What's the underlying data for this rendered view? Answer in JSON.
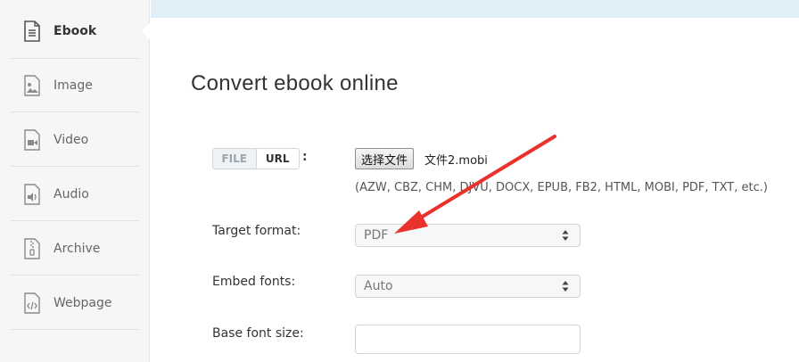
{
  "sidebar": {
    "items": [
      {
        "label": "Ebook",
        "icon": "ebook-icon",
        "active": true
      },
      {
        "label": "Image",
        "icon": "image-icon"
      },
      {
        "label": "Video",
        "icon": "video-icon"
      },
      {
        "label": "Audio",
        "icon": "audio-icon"
      },
      {
        "label": "Archive",
        "icon": "archive-icon"
      },
      {
        "label": "Webpage",
        "icon": "webpage-icon"
      }
    ]
  },
  "main": {
    "title": "Convert ebook online",
    "source_toggle": {
      "file": "FILE",
      "url": "URL",
      "selected": "URL"
    },
    "colon": ":",
    "file_button_label": "选择文件",
    "file_name": "文件2.mobi",
    "supported_formats": "(AZW, CBZ, CHM, DJVU, DOCX, EPUB, FB2, HTML, MOBI, PDF, TXT, etc.)",
    "target_format": {
      "label": "Target format:",
      "value": "PDF"
    },
    "embed_fonts": {
      "label": "Embed fonts:",
      "value": "Auto"
    },
    "base_font_size": {
      "label": "Base font size:",
      "value": ""
    }
  },
  "colors": {
    "annotation_arrow": "#e8322b",
    "top_bar": "#dfeef7",
    "sidebar_bg": "#f6f6f6"
  }
}
